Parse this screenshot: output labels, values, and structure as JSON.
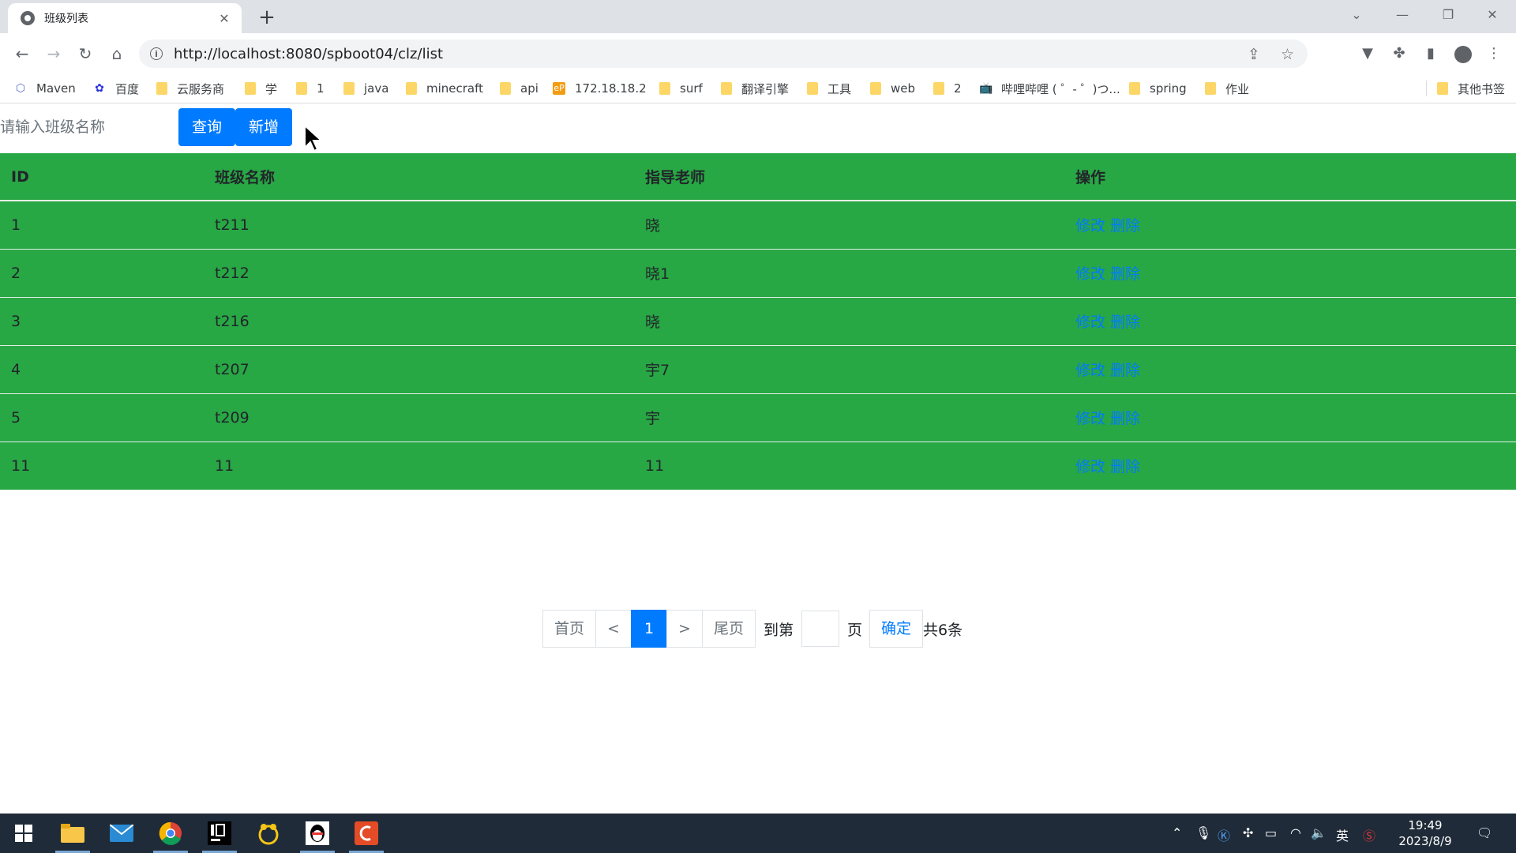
{
  "browser": {
    "tab_title": "班级列表",
    "url": "http://localhost:8080/spboot04/clz/list",
    "bookmarks": [
      {
        "label": "Maven",
        "icon": "maven-icon"
      },
      {
        "label": "百度",
        "icon": "baidu-icon"
      },
      {
        "label": "云服务商",
        "icon": "folder-icon"
      },
      {
        "label": "学",
        "icon": "folder-icon"
      },
      {
        "label": "1",
        "icon": "folder-icon"
      },
      {
        "label": "java",
        "icon": "folder-icon"
      },
      {
        "label": "minecraft",
        "icon": "folder-icon"
      },
      {
        "label": "api",
        "icon": "folder-icon"
      },
      {
        "label": "172.18.18.2",
        "icon": "ep-icon"
      },
      {
        "label": "surf",
        "icon": "folder-icon"
      },
      {
        "label": "翻译引擎",
        "icon": "folder-icon"
      },
      {
        "label": "工具",
        "icon": "folder-icon"
      },
      {
        "label": "web",
        "icon": "folder-icon"
      },
      {
        "label": "2",
        "icon": "folder-icon"
      },
      {
        "label": "哔哩哔哩 ( ゜- ゜)つ...",
        "icon": "bilibili-icon"
      },
      {
        "label": "spring",
        "icon": "folder-icon"
      },
      {
        "label": "作业",
        "icon": "folder-icon"
      }
    ],
    "other_bookmarks": "其他书签"
  },
  "search": {
    "placeholder": "请输入班级名称",
    "query_button": "查询",
    "add_button": "新增"
  },
  "table": {
    "headers": [
      "ID",
      "班级名称",
      "指导老师",
      "操作"
    ],
    "edit_label": "修改",
    "delete_label": "删除",
    "rows": [
      {
        "id": "1",
        "name": "t211",
        "teacher": "晓"
      },
      {
        "id": "2",
        "name": "t212",
        "teacher": "晓1"
      },
      {
        "id": "3",
        "name": "t216",
        "teacher": "晓"
      },
      {
        "id": "4",
        "name": "t207",
        "teacher": "宇7"
      },
      {
        "id": "5",
        "name": "t209",
        "teacher": "宇"
      },
      {
        "id": "11",
        "name": "11",
        "teacher": "11"
      }
    ]
  },
  "pagination": {
    "first": "首页",
    "prev": "<",
    "current": "1",
    "next": ">",
    "last": "尾页",
    "goto_prefix": "到第",
    "goto_suffix": "页",
    "confirm": "确定",
    "total": "共6条"
  },
  "taskbar": {
    "time": "19:49",
    "date": "2023/8/9",
    "ime": "英"
  },
  "colors": {
    "table_bg": "#28a745",
    "primary": "#007bff",
    "taskbar_bg": "#1f2b38"
  }
}
